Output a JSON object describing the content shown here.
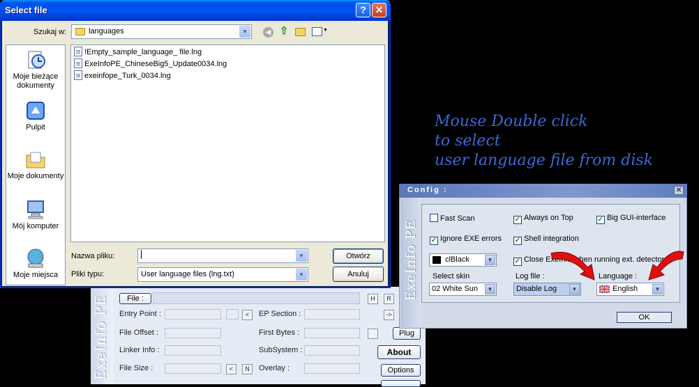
{
  "exeinfo": {
    "side_title": "ExeInfo PE",
    "file_button": "File :",
    "labels": {
      "entry_point": "Entry Point :",
      "file_offset": "File Offset :",
      "linker_info": "Linker Info :",
      "file_size": "File Size :",
      "ep_section": "EP Section :",
      "first_bytes": "First Bytes :",
      "subsystem": "SubSystem :",
      "overlay": "Overlay :"
    },
    "small_buttons": {
      "h": "H",
      "r": "R",
      "lt": "<",
      "n": "N",
      "arrow": "->"
    },
    "buttons": {
      "plug": "Plug",
      "about": "About",
      "options": "Options"
    }
  },
  "dialog": {
    "title": "Select file",
    "help_label": "?",
    "close_label": "✕",
    "look_in_label": "Szukaj w:",
    "look_in_value": "languages",
    "places": [
      {
        "icon": "recent-documents-icon",
        "label": "Moje bieżące dokumenty"
      },
      {
        "icon": "desktop-icon",
        "label": "Pulpit"
      },
      {
        "icon": "my-documents-icon",
        "label": "Moje dokumenty"
      },
      {
        "icon": "my-computer-icon",
        "label": "Mój komputer"
      },
      {
        "icon": "network-places-icon",
        "label": "Moje miejsca"
      }
    ],
    "files": [
      "!Empty_sample_language_ file.lng",
      "ExeInfoPE_ChineseBig5_Update0034.lng",
      "exeinfope_Turk_0034.lng"
    ],
    "file_name_label": "Nazwa pliku:",
    "file_name_value": "",
    "file_type_label": "Pliki typu:",
    "file_type_value": "User language files (lng.txt)",
    "open_button": "Otwórz",
    "cancel_button": "Anuluj"
  },
  "caption": {
    "line1": "Mouse Double click",
    "line2": "to select",
    "line3": "user language file from disk",
    "color": "#3a6ad8"
  },
  "config": {
    "title": "Config :",
    "side_title": "ExeInfo PE",
    "fast_scan": {
      "label": "Fast Scan",
      "checked": false
    },
    "always_on_top": {
      "label": "Always on Top",
      "checked": true
    },
    "big_gui": {
      "label": "Big GUI-interface",
      "checked": true
    },
    "ignore_exe": {
      "label": "Ignore EXE errors",
      "checked": true
    },
    "shell_integration": {
      "label": "Shell integration",
      "checked": true
    },
    "close_exeinfo": {
      "label": "Close ExeInfo when running ext. detectors",
      "checked": true
    },
    "color_value": "clBlack",
    "select_skin_label": "Select skin",
    "skin_value": "02 White Sun",
    "log_file_label": "Log file :",
    "log_value": "Disable Log",
    "language_label": "Language :",
    "language_value": "English",
    "ok_button": "OK"
  }
}
